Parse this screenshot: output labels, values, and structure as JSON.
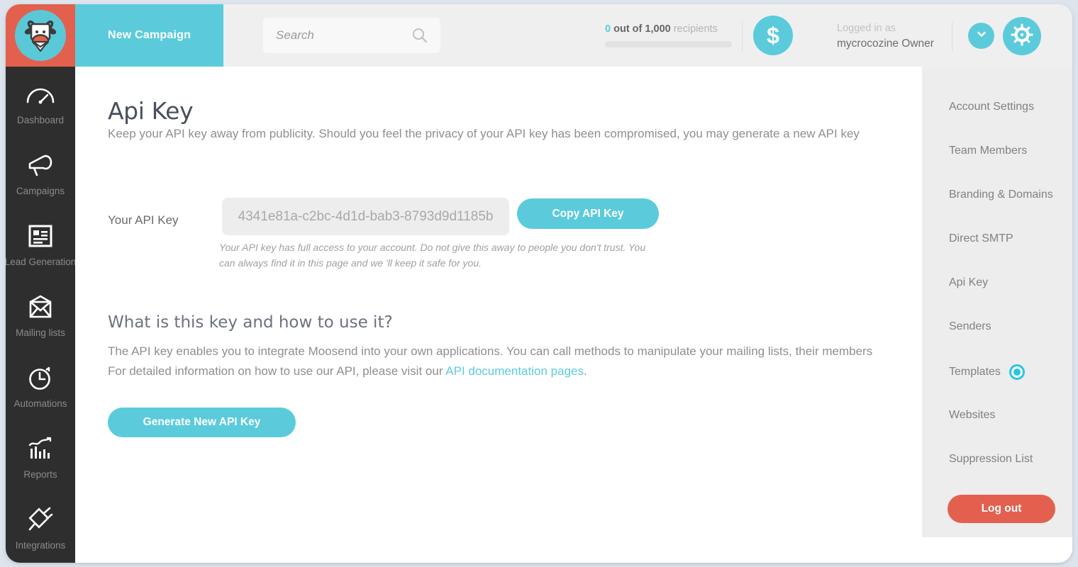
{
  "header": {
    "logo_icon": "cow-mascot-icon",
    "new_campaign_label": "New Campaign",
    "search_placeholder": "Search",
    "search_value": "",
    "search_icon": "search-icon",
    "recipients": {
      "count": "0",
      "middle": " out of ",
      "limit": "1,000",
      "suffix": " recipients",
      "progress_percent": 0
    },
    "dollar_icon": "dollar-sign-icon",
    "logged_in_label": "Logged in as",
    "account_name": "mycrocozine Owner",
    "chevron_icon": "chevron-down-icon",
    "gear_icon": "gear-icon"
  },
  "left_sidebar": {
    "items": [
      {
        "label": "Dashboard",
        "icon": "speedometer-icon"
      },
      {
        "label": "Campaigns",
        "icon": "megaphone-icon"
      },
      {
        "label": "Lead Generation",
        "icon": "form-icon"
      },
      {
        "label": "Mailing lists",
        "icon": "envelope-icon"
      },
      {
        "label": "Automations",
        "icon": "clock-icon"
      },
      {
        "label": "Reports",
        "icon": "bar-chart-icon"
      },
      {
        "label": "Integrations",
        "icon": "plug-icon"
      }
    ]
  },
  "main": {
    "title": "Api Key",
    "subtitle": "Keep your API key away from publicity. Should you feel the privacy of your API key has been compromised, you may generate a new API key",
    "api_key_label": "Your API Key",
    "api_key_value": "4341e81a-c2bc-4d1d-bab3-8793d9d1185b",
    "copy_button": "Copy API Key",
    "api_key_note": "Your API key has full access to your account. Do not give this away to people you don't trust. You can always find it in this page and we 'll keep it safe for you.",
    "section_title": "What is this key and how to use it?",
    "section_line1": "The API key enables you to integrate Moosend into your own applications. You can call methods to manipulate your mailing lists, their members",
    "section_line2_pre": "For detailed information on how to use our API, please visit our ",
    "section_link": "API documentation pages",
    "section_line2_post": ".",
    "generate_button": "Generate New API Key"
  },
  "right_sidebar": {
    "items": [
      {
        "label": "Account Settings",
        "selected": false
      },
      {
        "label": "Team Members",
        "selected": false
      },
      {
        "label": "Branding & Domains",
        "selected": false
      },
      {
        "label": "Direct SMTP",
        "selected": false
      },
      {
        "label": "Api Key",
        "selected": false
      },
      {
        "label": "Senders",
        "selected": false
      },
      {
        "label": "Templates",
        "selected": true
      },
      {
        "label": "Websites",
        "selected": false
      },
      {
        "label": "Suppression List",
        "selected": false
      }
    ],
    "logout_label": "Log out"
  },
  "colors": {
    "accent_cyan": "#5bcbdc",
    "accent_red": "#e4604e",
    "sidebar_dark": "#2e2e2e",
    "panel_gray": "#ededed",
    "radio_cyan": "#29c6e2"
  }
}
